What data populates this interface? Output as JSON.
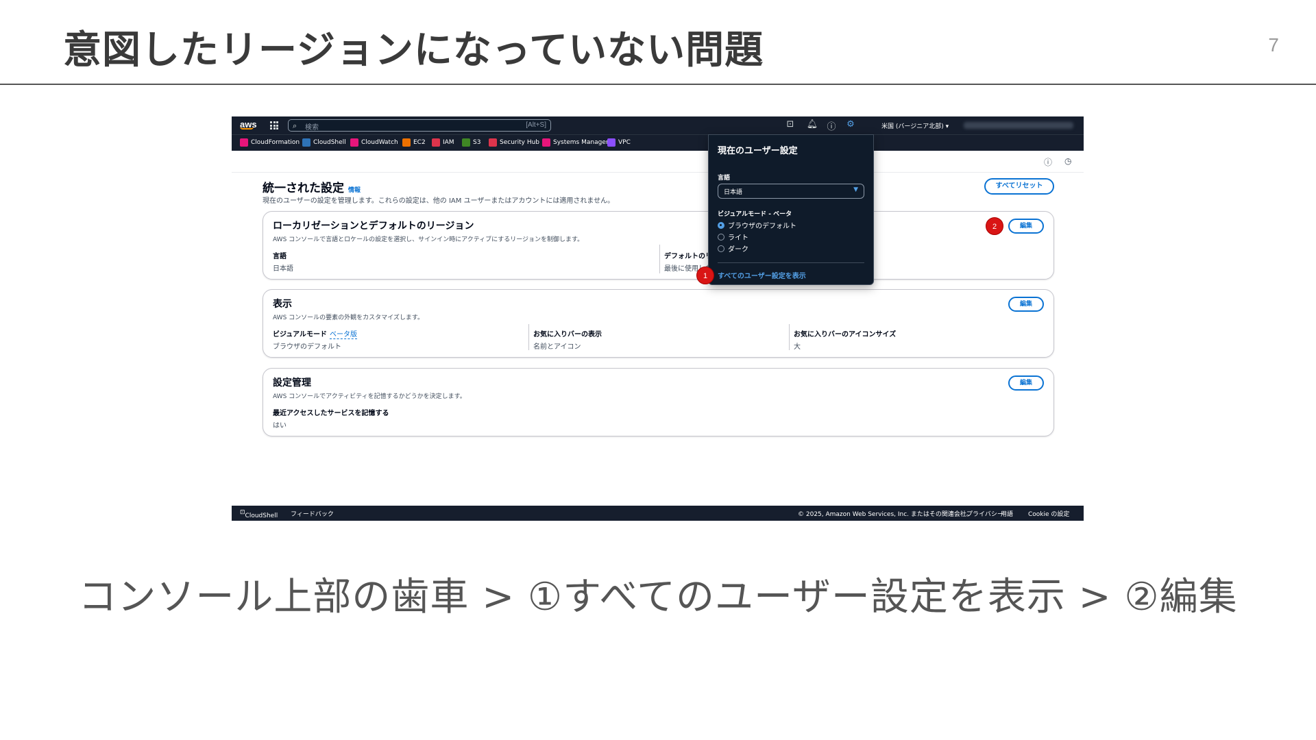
{
  "slide": {
    "title": "意図したリージョンになっていない問題",
    "page_number": "7",
    "caption": "コンソール上部の歯車 > ①すべてのユーザー設定を表示 > ②編集"
  },
  "topbar": {
    "logo": "aws",
    "search_placeholder": "検索",
    "search_shortcut": "[Alt+S]",
    "region": "米国 (バージニア北部) ▾"
  },
  "favorites": [
    {
      "label": "CloudFormation",
      "color": "#e7157b"
    },
    {
      "label": "CloudShell",
      "color": "#2e73b8"
    },
    {
      "label": "CloudWatch",
      "color": "#e7157b"
    },
    {
      "label": "EC2",
      "color": "#ed7100"
    },
    {
      "label": "IAM",
      "color": "#dd344c"
    },
    {
      "label": "S3",
      "color": "#3f8624"
    },
    {
      "label": "Security Hub",
      "color": "#dd344c"
    },
    {
      "label": "Systems Manager",
      "color": "#e7157b"
    },
    {
      "label": "VPC",
      "color": "#8c4fff"
    }
  ],
  "page": {
    "title": "統一された設定",
    "info_link": "情報",
    "description": "現在のユーザーの設定を管理します。これらの設定は、他の IAM ユーザーまたはアカウントには適用されません。",
    "reset_button": "すべてリセット"
  },
  "cards": {
    "localization": {
      "title": "ローカリゼーションとデフォルトのリージョン",
      "description": "AWS コンソールで言語とロケールの設定を選択し、サインイン時にアクティブにするリージョンを制御します。",
      "edit": "編集",
      "language_label": "言語",
      "language_value": "日本語",
      "default_region_label": "デフォルトのリ",
      "default_region_value": "最後に使用した"
    },
    "display": {
      "title": "表示",
      "description": "AWS コンソールの要素の外観をカスタマイズします。",
      "edit": "編集",
      "visual_mode_label": "ビジュアルモード",
      "visual_mode_beta": "ベータ版",
      "visual_mode_value": "ブラウザのデフォルト",
      "favorites_bar_label": "お気に入りバーの表示",
      "favorites_bar_value": "名前とアイコン",
      "favorites_icon_label": "お気に入りバーのアイコンサイズ",
      "favorites_icon_value": "大"
    },
    "settings_mgmt": {
      "title": "設定管理",
      "description": "AWS コンソールでアクティビティを記憶するかどうかを決定します。",
      "edit": "編集",
      "recent_label": "最近アクセスしたサービスを記憶する",
      "recent_value": "はい"
    }
  },
  "popover": {
    "title": "現在のユーザー設定",
    "language_label": "言語",
    "language_value": "日本語",
    "visual_mode_label": "ビジュアルモード - ベータ",
    "options": [
      "ブラウザのデフォルト",
      "ライト",
      "ダーク"
    ],
    "selected_option": "ブラウザのデフォルト",
    "view_all_link": "すべてのユーザー設定を表示"
  },
  "markers": [
    "1",
    "2"
  ],
  "footer": {
    "cloudshell": "CloudShell",
    "feedback": "フィードバック",
    "copyright": "© 2025, Amazon Web Services, Inc. またはその関連会社。",
    "privacy": "プライバシー",
    "terms": "用語",
    "cookie": "Cookie の設定"
  }
}
